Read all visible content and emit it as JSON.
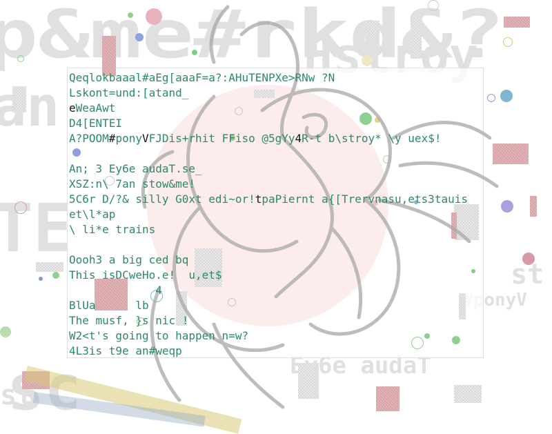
{
  "lines": [
    {
      "segments": [
        {
          "t": "Qeqlokbaaal#aEg[aaaF=a?:AHuTENPXe>RNw ?N",
          "c": "g"
        }
      ]
    },
    {
      "segments": [
        {
          "t": "Lskont=und:[atand_",
          "c": "g"
        }
      ]
    },
    {
      "segments": [
        {
          "t": "e",
          "c": "d"
        },
        {
          "t": "WeaAwt",
          "c": "g"
        }
      ]
    },
    {
      "segments": [
        {
          "t": "D4[ENTEI",
          "c": "g"
        }
      ]
    },
    {
      "segments": [
        {
          "t": "A?POOM",
          "c": "g"
        },
        {
          "t": "#",
          "c": "d"
        },
        {
          "t": "pony",
          "c": "g"
        },
        {
          "t": "V",
          "c": "d"
        },
        {
          "t": "FJDis+rhit FFiso @5gYy",
          "c": "g"
        },
        {
          "t": "4",
          "c": "d"
        },
        {
          "t": "R-t b\\stroy* \\y uex$!",
          "c": "g"
        }
      ]
    },
    {
      "segments": [
        {
          "t": "",
          "c": "g"
        }
      ]
    },
    {
      "segments": [
        {
          "t": "An; 3 Ey6e audaT.se_",
          "c": "g"
        }
      ]
    },
    {
      "segments": [
        {
          "t": "XSZ:n\\ 7an stow&me!",
          "c": "g"
        }
      ]
    },
    {
      "segments": [
        {
          "t": "5C6r D/?& silly G0xt edi~or!",
          "c": "g"
        },
        {
          "t": "t",
          "c": "d"
        },
        {
          "t": "paPiernt a{[Trervnasu,ets3tauis",
          "c": "g"
        }
      ]
    },
    {
      "segments": [
        {
          "t": "et\\l*ap",
          "c": "g"
        }
      ]
    },
    {
      "segments": [
        {
          "t": "\\ li*e trains",
          "c": "g"
        }
      ]
    },
    {
      "segments": [
        {
          "t": "",
          "c": "g"
        }
      ]
    },
    {
      "segments": [
        {
          "t": "Oooh3 a big ced bq",
          "c": "g"
        }
      ]
    },
    {
      "segments": [
        {
          "t": "This isDCweHo.e!  u,et$",
          "c": "g"
        }
      ]
    },
    {
      "segments": [
        {
          "t": "             4",
          "c": "g"
        }
      ]
    },
    {
      "segments": [
        {
          "t": "BlUa      lb",
          "c": "g"
        }
      ]
    },
    {
      "segments": [
        {
          "t": "The musf, }s nic !",
          "c": "g"
        }
      ]
    },
    {
      "segments": [
        {
          "t": "W2<t's going to happen n=w?",
          "c": "g"
        }
      ]
    },
    {
      "segments": [
        {
          "t": "4L3is t9e an#weqp",
          "c": "g"
        }
      ]
    }
  ],
  "background_glyphs": [
    "p&me#rkd&?",
    "an",
    "Ey6e audaT",
    "TE",
    "st",
    "#ponyV",
    "sc",
    "Hstroy",
    "st"
  ],
  "colors": {
    "text_green": "#2a8a6a",
    "text_dark": "#111111",
    "sun": "#e26b6b"
  }
}
